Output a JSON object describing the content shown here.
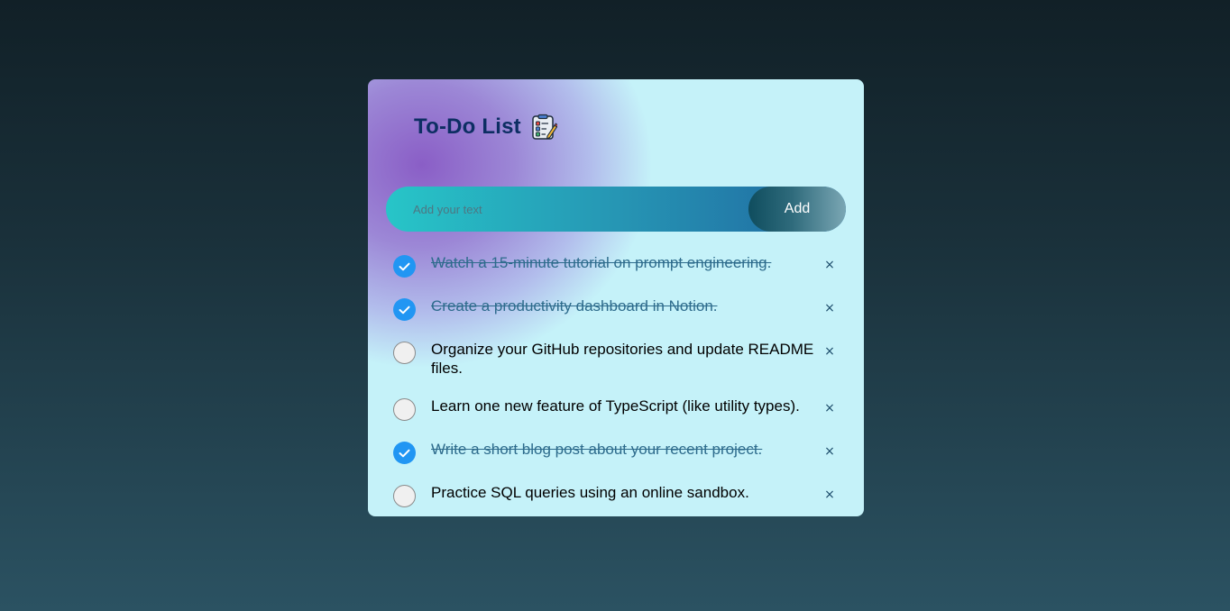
{
  "app": {
    "title": "To-Do List",
    "title_icon": "checklist-clipboard-icon"
  },
  "input": {
    "placeholder": "Add your text",
    "value": "",
    "add_label": "Add"
  },
  "colors": {
    "check_done": "#2196f3",
    "title": "#0d2e63",
    "done_text": "#2d6b8c",
    "card_bg": "#c5f2f9"
  },
  "tasks": [
    {
      "text": "Watch a 15-minute tutorial on prompt engineering.",
      "done": true,
      "delete_label": "×"
    },
    {
      "text": "Create a productivity dashboard in Notion.",
      "done": true,
      "delete_label": "×"
    },
    {
      "text": "Organize your GitHub repositories and update README files.",
      "done": false,
      "delete_label": "×"
    },
    {
      "text": "Learn one new feature of TypeScript (like utility types).",
      "done": false,
      "delete_label": "×"
    },
    {
      "text": "Write a short blog post about your recent project.",
      "done": true,
      "delete_label": "×"
    },
    {
      "text": "Practice SQL queries using an online sandbox.",
      "done": false,
      "delete_label": "×"
    }
  ]
}
